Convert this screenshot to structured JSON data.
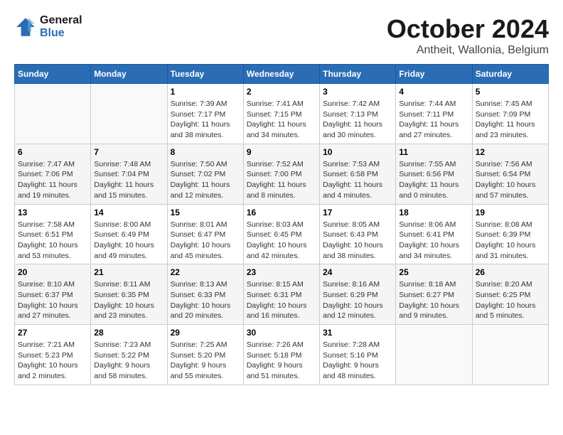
{
  "logo": {
    "line1": "General",
    "line2": "Blue"
  },
  "title": "October 2024",
  "location": "Antheit, Wallonia, Belgium",
  "weekdays": [
    "Sunday",
    "Monday",
    "Tuesday",
    "Wednesday",
    "Thursday",
    "Friday",
    "Saturday"
  ],
  "weeks": [
    [
      {
        "day": "",
        "info": ""
      },
      {
        "day": "",
        "info": ""
      },
      {
        "day": "1",
        "info": "Sunrise: 7:39 AM\nSunset: 7:17 PM\nDaylight: 11 hours and 38 minutes."
      },
      {
        "day": "2",
        "info": "Sunrise: 7:41 AM\nSunset: 7:15 PM\nDaylight: 11 hours and 34 minutes."
      },
      {
        "day": "3",
        "info": "Sunrise: 7:42 AM\nSunset: 7:13 PM\nDaylight: 11 hours and 30 minutes."
      },
      {
        "day": "4",
        "info": "Sunrise: 7:44 AM\nSunset: 7:11 PM\nDaylight: 11 hours and 27 minutes."
      },
      {
        "day": "5",
        "info": "Sunrise: 7:45 AM\nSunset: 7:09 PM\nDaylight: 11 hours and 23 minutes."
      }
    ],
    [
      {
        "day": "6",
        "info": "Sunrise: 7:47 AM\nSunset: 7:06 PM\nDaylight: 11 hours and 19 minutes."
      },
      {
        "day": "7",
        "info": "Sunrise: 7:48 AM\nSunset: 7:04 PM\nDaylight: 11 hours and 15 minutes."
      },
      {
        "day": "8",
        "info": "Sunrise: 7:50 AM\nSunset: 7:02 PM\nDaylight: 11 hours and 12 minutes."
      },
      {
        "day": "9",
        "info": "Sunrise: 7:52 AM\nSunset: 7:00 PM\nDaylight: 11 hours and 8 minutes."
      },
      {
        "day": "10",
        "info": "Sunrise: 7:53 AM\nSunset: 6:58 PM\nDaylight: 11 hours and 4 minutes."
      },
      {
        "day": "11",
        "info": "Sunrise: 7:55 AM\nSunset: 6:56 PM\nDaylight: 11 hours and 0 minutes."
      },
      {
        "day": "12",
        "info": "Sunrise: 7:56 AM\nSunset: 6:54 PM\nDaylight: 10 hours and 57 minutes."
      }
    ],
    [
      {
        "day": "13",
        "info": "Sunrise: 7:58 AM\nSunset: 6:51 PM\nDaylight: 10 hours and 53 minutes."
      },
      {
        "day": "14",
        "info": "Sunrise: 8:00 AM\nSunset: 6:49 PM\nDaylight: 10 hours and 49 minutes."
      },
      {
        "day": "15",
        "info": "Sunrise: 8:01 AM\nSunset: 6:47 PM\nDaylight: 10 hours and 45 minutes."
      },
      {
        "day": "16",
        "info": "Sunrise: 8:03 AM\nSunset: 6:45 PM\nDaylight: 10 hours and 42 minutes."
      },
      {
        "day": "17",
        "info": "Sunrise: 8:05 AM\nSunset: 6:43 PM\nDaylight: 10 hours and 38 minutes."
      },
      {
        "day": "18",
        "info": "Sunrise: 8:06 AM\nSunset: 6:41 PM\nDaylight: 10 hours and 34 minutes."
      },
      {
        "day": "19",
        "info": "Sunrise: 8:08 AM\nSunset: 6:39 PM\nDaylight: 10 hours and 31 minutes."
      }
    ],
    [
      {
        "day": "20",
        "info": "Sunrise: 8:10 AM\nSunset: 6:37 PM\nDaylight: 10 hours and 27 minutes."
      },
      {
        "day": "21",
        "info": "Sunrise: 8:11 AM\nSunset: 6:35 PM\nDaylight: 10 hours and 23 minutes."
      },
      {
        "day": "22",
        "info": "Sunrise: 8:13 AM\nSunset: 6:33 PM\nDaylight: 10 hours and 20 minutes."
      },
      {
        "day": "23",
        "info": "Sunrise: 8:15 AM\nSunset: 6:31 PM\nDaylight: 10 hours and 16 minutes."
      },
      {
        "day": "24",
        "info": "Sunrise: 8:16 AM\nSunset: 6:29 PM\nDaylight: 10 hours and 12 minutes."
      },
      {
        "day": "25",
        "info": "Sunrise: 8:18 AM\nSunset: 6:27 PM\nDaylight: 10 hours and 9 minutes."
      },
      {
        "day": "26",
        "info": "Sunrise: 8:20 AM\nSunset: 6:25 PM\nDaylight: 10 hours and 5 minutes."
      }
    ],
    [
      {
        "day": "27",
        "info": "Sunrise: 7:21 AM\nSunset: 5:23 PM\nDaylight: 10 hours and 2 minutes."
      },
      {
        "day": "28",
        "info": "Sunrise: 7:23 AM\nSunset: 5:22 PM\nDaylight: 9 hours and 58 minutes."
      },
      {
        "day": "29",
        "info": "Sunrise: 7:25 AM\nSunset: 5:20 PM\nDaylight: 9 hours and 55 minutes."
      },
      {
        "day": "30",
        "info": "Sunrise: 7:26 AM\nSunset: 5:18 PM\nDaylight: 9 hours and 51 minutes."
      },
      {
        "day": "31",
        "info": "Sunrise: 7:28 AM\nSunset: 5:16 PM\nDaylight: 9 hours and 48 minutes."
      },
      {
        "day": "",
        "info": ""
      },
      {
        "day": "",
        "info": ""
      }
    ]
  ]
}
